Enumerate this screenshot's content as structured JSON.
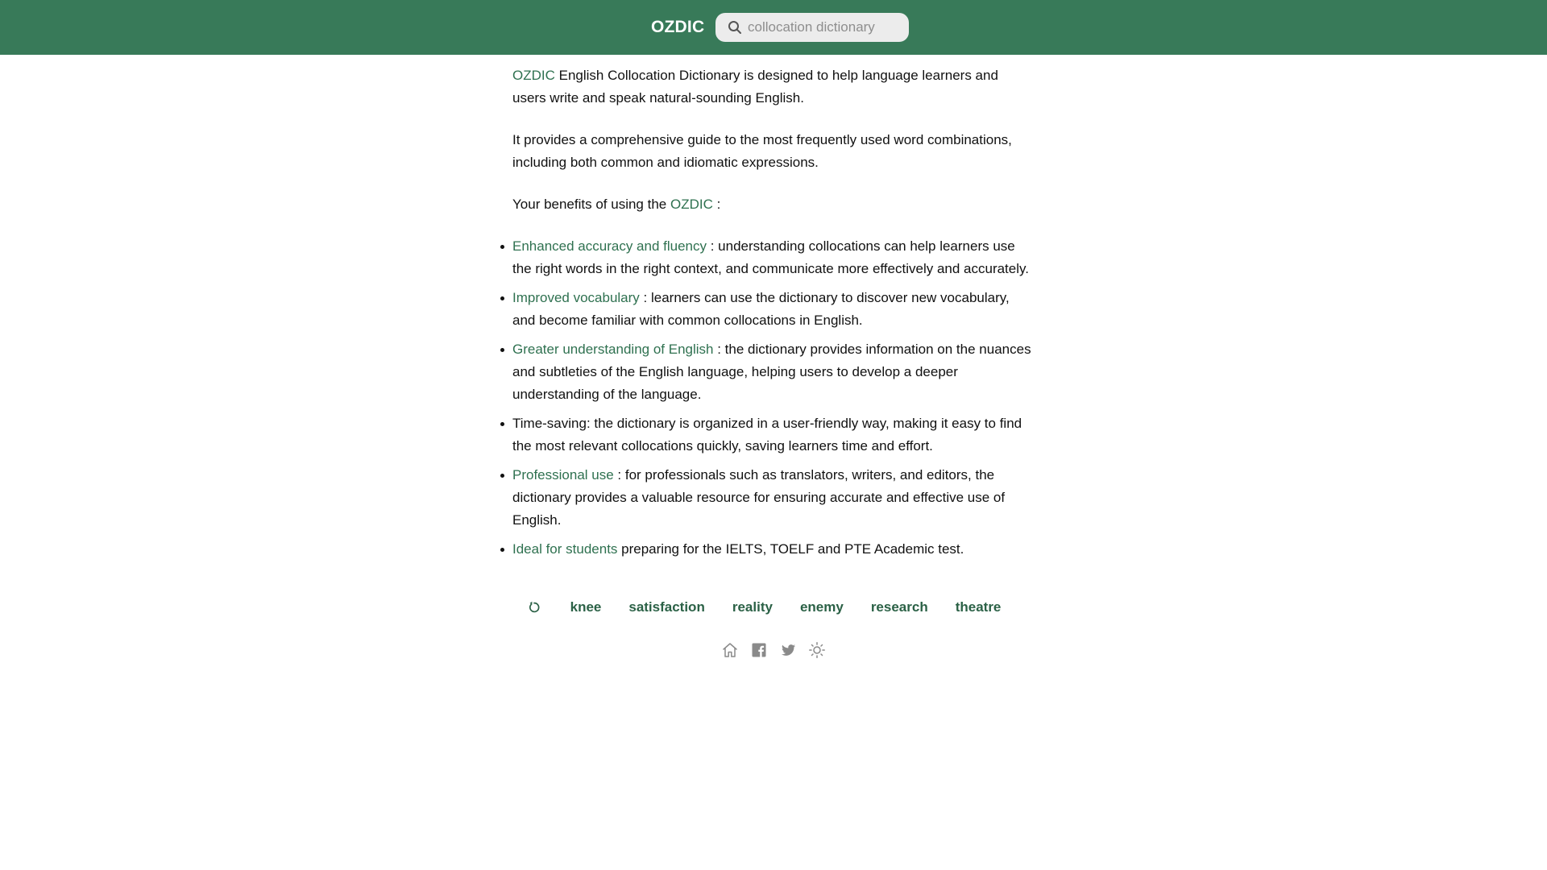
{
  "header": {
    "logo": "OZDIC",
    "search": {
      "placeholder": "collocation dictionary",
      "value": ""
    }
  },
  "intro": {
    "p1_link": "OZDIC",
    "p1_text": " English Collocation Dictionary is designed to help language learners and users write and speak natural-sounding English.",
    "p2_text": "It provides a comprehensive guide to the most frequently used word combinations, including both common and idiomatic expressions.",
    "p3_text": "Your benefits of using the ",
    "p3_link": "OZDIC",
    "p3_tail": " :"
  },
  "benefits": [
    {
      "link": "Enhanced accuracy and fluency",
      "text": " : understanding collocations can help learners use the right words in the right context, and communicate more effectively and accurately."
    },
    {
      "link": "Improved vocabulary",
      "text": " : learners can use the dictionary to discover new vocabulary, and become familiar with common collocations in English."
    },
    {
      "link": "Greater understanding of English",
      "text": " : the dictionary provides information on the nuances and subtleties of the English language, helping users to develop a deeper understanding of the language."
    },
    {
      "link": "",
      "text": "Time-saving: the dictionary is organized in a user-friendly way, making it easy to find the most relevant collocations quickly, saving learners time and effort."
    },
    {
      "link": "Professional use",
      "text": " : for professionals such as translators, writers, and editors, the dictionary provides a valuable resource for ensuring accurate and effective use of English."
    },
    {
      "link": "Ideal for students",
      "text": " preparing for the IELTS, TOELF and PTE Academic test."
    }
  ],
  "recent_words": [
    "knee",
    "satisfaction",
    "reality",
    "enemy",
    "research",
    "theatre"
  ],
  "icons": {
    "history": "history-icon",
    "footer": [
      "home-icon",
      "facebook-icon",
      "twitter-icon",
      "sun-icon"
    ]
  },
  "colors": {
    "header_bg": "#387a59",
    "link": "#2f7150",
    "recent_word": "#2b6146",
    "footer_icon": "#8a8a8a"
  }
}
